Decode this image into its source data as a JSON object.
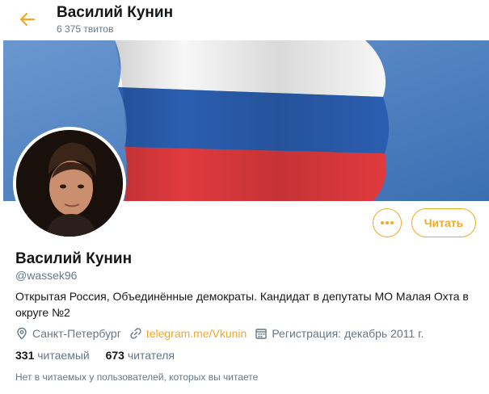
{
  "header": {
    "title": "Василий Кунин",
    "tweets_count": "6 375 твитов",
    "back_icon": "arrow-left-icon"
  },
  "profile": {
    "name": "Василий Кунин",
    "handle": "@wassek96",
    "bio": "Открытая Россия, Объединённые демократы. Кандидат в депутаты МО Малая Охта в округе №2",
    "location": "Санкт-Петербург",
    "website": "telegram.me/Vkunin",
    "joined": "Регистрация: декабрь 2011 г."
  },
  "actions": {
    "follow_label": "Читать",
    "more_icon": "more-dots-icon"
  },
  "stats": {
    "following_count": "331",
    "following_label": "читаемый",
    "followers_count": "673",
    "followers_label": "читателя"
  },
  "note": "Нет в читаемых у пользователей, которых вы читаете",
  "colors": {
    "accent": "#f4a825",
    "muted": "#657786",
    "text": "#14171a"
  }
}
